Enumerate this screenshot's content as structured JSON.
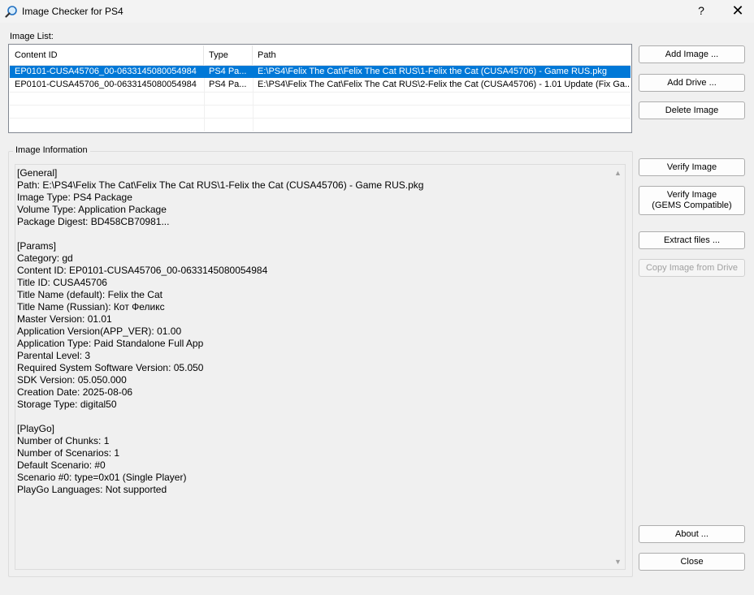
{
  "window": {
    "title": "Image Checker for PS4",
    "help_label": "?",
    "close_label": "✕"
  },
  "image_list": {
    "label": "Image List:",
    "columns": [
      "Content ID",
      "Type",
      "Path"
    ],
    "rows": [
      {
        "content_id": "EP0101-CUSA45706_00-0633145080054984",
        "type": "PS4 Pa...",
        "path": "E:\\PS4\\Felix The Cat\\Felix The Cat RUS\\1-Felix the Cat (CUSA45706) - Game RUS.pkg",
        "selected": true
      },
      {
        "content_id": "EP0101-CUSA45706_00-0633145080054984",
        "type": "PS4 Pa...",
        "path": "E:\\PS4\\Felix The Cat\\Felix The Cat RUS\\2-Felix the Cat (CUSA45706) - 1.01 Update (Fix Ga...",
        "selected": false
      }
    ]
  },
  "buttons": {
    "add_image": "Add Image ...",
    "add_drive": "Add Drive ...",
    "delete_image": "Delete Image",
    "verify_image": "Verify Image",
    "verify_gems_line1": "Verify Image",
    "verify_gems_line2": "(GEMS Compatible)",
    "extract_files": "Extract files ...",
    "copy_image": "Copy Image from Drive",
    "about": "About ...",
    "close": "Close"
  },
  "image_information": {
    "label": "Image Information",
    "text": "[General]\nPath: E:\\PS4\\Felix The Cat\\Felix The Cat RUS\\1-Felix the Cat (CUSA45706) - Game RUS.pkg\nImage Type: PS4 Package\nVolume Type: Application Package\nPackage Digest: BD458CB70981...\n\n[Params]\nCategory: gd\nContent ID: EP0101-CUSA45706_00-0633145080054984\nTitle ID: CUSA45706\nTitle Name (default): Felix the Cat\nTitle Name (Russian): Кот Феликс\nMaster Version: 01.01\nApplication Version(APP_VER): 01.00\nApplication Type: Paid Standalone Full App\nParental Level: 3\nRequired System Software Version: 05.050\nSDK Version: 05.050.000\nCreation Date: 2025-08-06\nStorage Type: digital50\n\n[PlayGo]\nNumber of Chunks: 1\nNumber of Scenarios: 1\nDefault Scenario: #0\nScenario #0: type=0x01 (Single Player)\nPlayGo Languages: Not supported"
  }
}
